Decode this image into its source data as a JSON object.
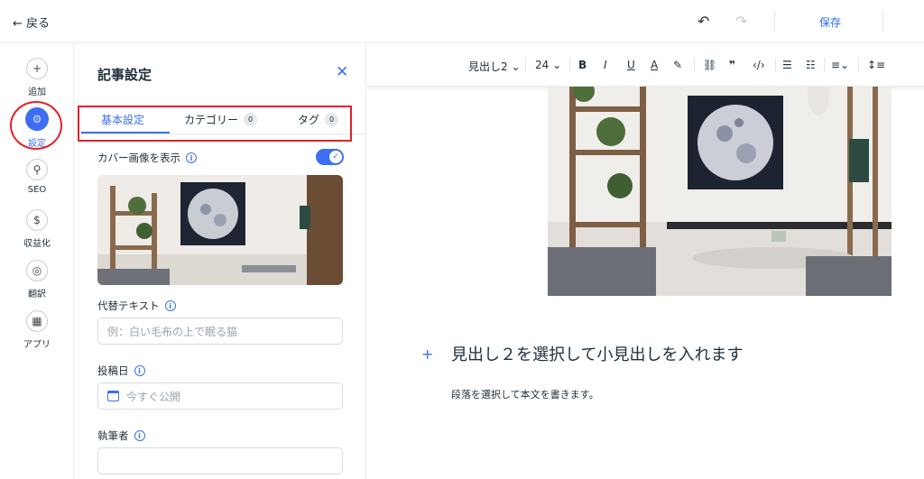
{
  "topbar": {
    "back_label": "← 戻る",
    "save_label": "保存"
  },
  "rail": {
    "items": [
      {
        "label": "追加",
        "icon": "plus-icon",
        "glyph": "+"
      },
      {
        "label": "設定",
        "icon": "gear-icon",
        "glyph": "⚙"
      },
      {
        "label": "SEO",
        "icon": "search-icon",
        "glyph": "⚲"
      },
      {
        "label": "収益化",
        "icon": "coin-icon",
        "glyph": "$"
      },
      {
        "label": "翻訳",
        "icon": "globe-icon",
        "glyph": "◎"
      },
      {
        "label": "アプリ",
        "icon": "apps-icon",
        "glyph": "▦"
      }
    ]
  },
  "panel": {
    "title": "記事設定",
    "tabs": [
      {
        "label": "基本設定"
      },
      {
        "label": "カテゴリー",
        "count": "0"
      },
      {
        "label": "タグ",
        "count": "0"
      }
    ],
    "cover_label": "カバー画像を表示",
    "alt_label": "代替テキスト",
    "alt_placeholder": "例：白い毛布の上で眠る猫",
    "date_label": "投稿日",
    "date_value": "今すぐ公開",
    "author_label": "執筆者"
  },
  "toolbar": {
    "heading_style": "見出し2",
    "font_size": "24"
  },
  "editor": {
    "heading": "見出し２を選択して小見出しを入れます",
    "paragraph": "段落を選択して本文を書きます。"
  },
  "colors": {
    "accent": "#3d6ef2",
    "annotation": "#e6202a"
  }
}
